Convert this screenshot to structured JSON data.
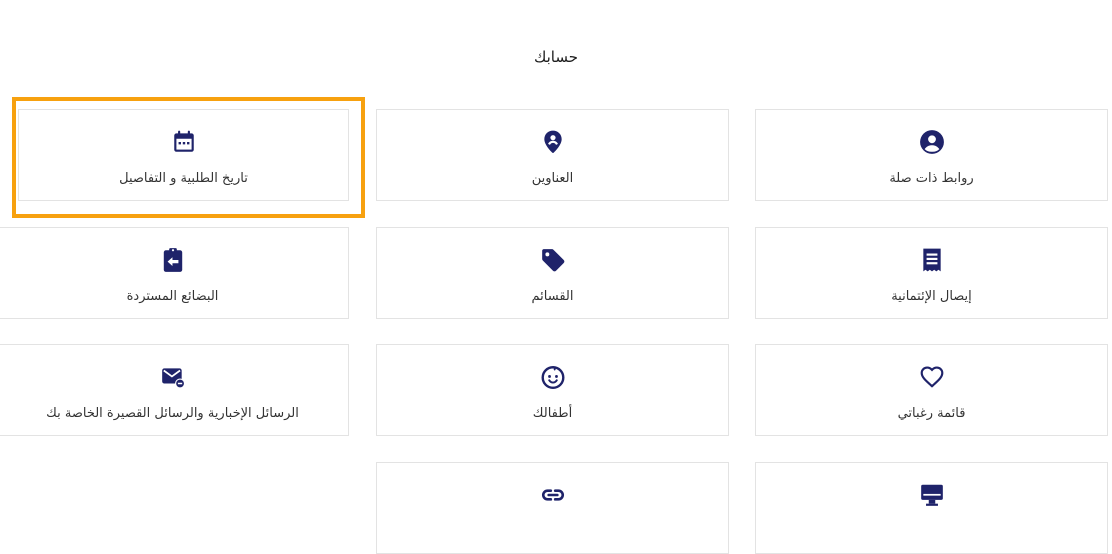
{
  "page": {
    "title": "حسابك"
  },
  "colors": {
    "icon": "#1f236a",
    "highlight": "#f7a10f",
    "border": "#e3e3e3"
  },
  "tiles": [
    {
      "label": "روابط ذات صلة",
      "icon": "user-circle-icon"
    },
    {
      "label": "العناوين",
      "icon": "map-pin-icon"
    },
    {
      "label": "تاريخ الطلبية و التفاصيل",
      "icon": "calendar-icon"
    },
    {
      "label": "إيصال الإئتمانية",
      "icon": "receipt-icon"
    },
    {
      "label": "القسائم",
      "icon": "tag-icon"
    },
    {
      "label": "البضائع المستردة",
      "icon": "clipboard-return-icon"
    },
    {
      "label": "قائمة رغباتي",
      "icon": "heart-icon"
    },
    {
      "label": "أطفالك",
      "icon": "baby-face-icon"
    },
    {
      "label": "الرسائل الإخبارية والرسائل القصيرة الخاصة بك",
      "icon": "mail-minus-icon"
    },
    {
      "label": "",
      "icon": "monitor-icon"
    },
    {
      "label": "",
      "icon": "link-icon"
    }
  ]
}
